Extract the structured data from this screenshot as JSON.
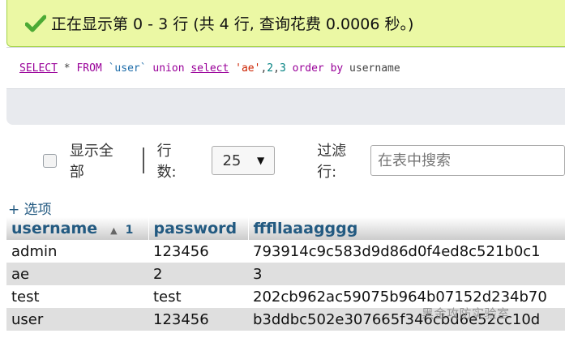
{
  "status": {
    "message": "正在显示第 0 - 3 行 (共 4 行, 查询花费 0.0006 秒。)",
    "icon": "checkmark-icon",
    "icon_color": "#4caa35"
  },
  "sql": {
    "tokens": [
      {
        "t": "SELECT",
        "c": "kw-ul"
      },
      {
        "t": " * ",
        "c": "plain"
      },
      {
        "t": "FROM",
        "c": "kw"
      },
      {
        "t": " ",
        "c": "plain"
      },
      {
        "t": "`user`",
        "c": "id"
      },
      {
        "t": " ",
        "c": "plain"
      },
      {
        "t": "union",
        "c": "kw"
      },
      {
        "t": " ",
        "c": "plain"
      },
      {
        "t": "select",
        "c": "kw-ul"
      },
      {
        "t": " ",
        "c": "plain"
      },
      {
        "t": "'ae'",
        "c": "str"
      },
      {
        "t": ",",
        "c": "plain"
      },
      {
        "t": "2",
        "c": "num"
      },
      {
        "t": ",",
        "c": "plain"
      },
      {
        "t": "3",
        "c": "num"
      },
      {
        "t": " ",
        "c": "plain"
      },
      {
        "t": "order by",
        "c": "kw"
      },
      {
        "t": " username",
        "c": "plain"
      }
    ]
  },
  "controls": {
    "show_all_label": "显示全部",
    "rows_label": "行数:",
    "rows_value": "25",
    "filter_label": "过滤行:",
    "search_placeholder": "在表中搜索"
  },
  "options_link": "+ 选项",
  "table": {
    "columns": [
      {
        "label": "username",
        "sort_arrow": "▲",
        "sort_index": "1"
      },
      {
        "label": "password"
      },
      {
        "label": "fffllaaagggg"
      }
    ],
    "rows": [
      [
        "admin",
        "123456",
        "793914c9c583d9d86d0f4ed8c521b0c1"
      ],
      [
        "ae",
        "2",
        "3"
      ],
      [
        "test",
        "test",
        "202cb962ac59075b964b07152d234b70"
      ],
      [
        "user",
        "123456",
        "b3ddbc502e307665f346cbd6e52cc10d"
      ]
    ]
  },
  "watermark": "黑金攻防实验室"
}
